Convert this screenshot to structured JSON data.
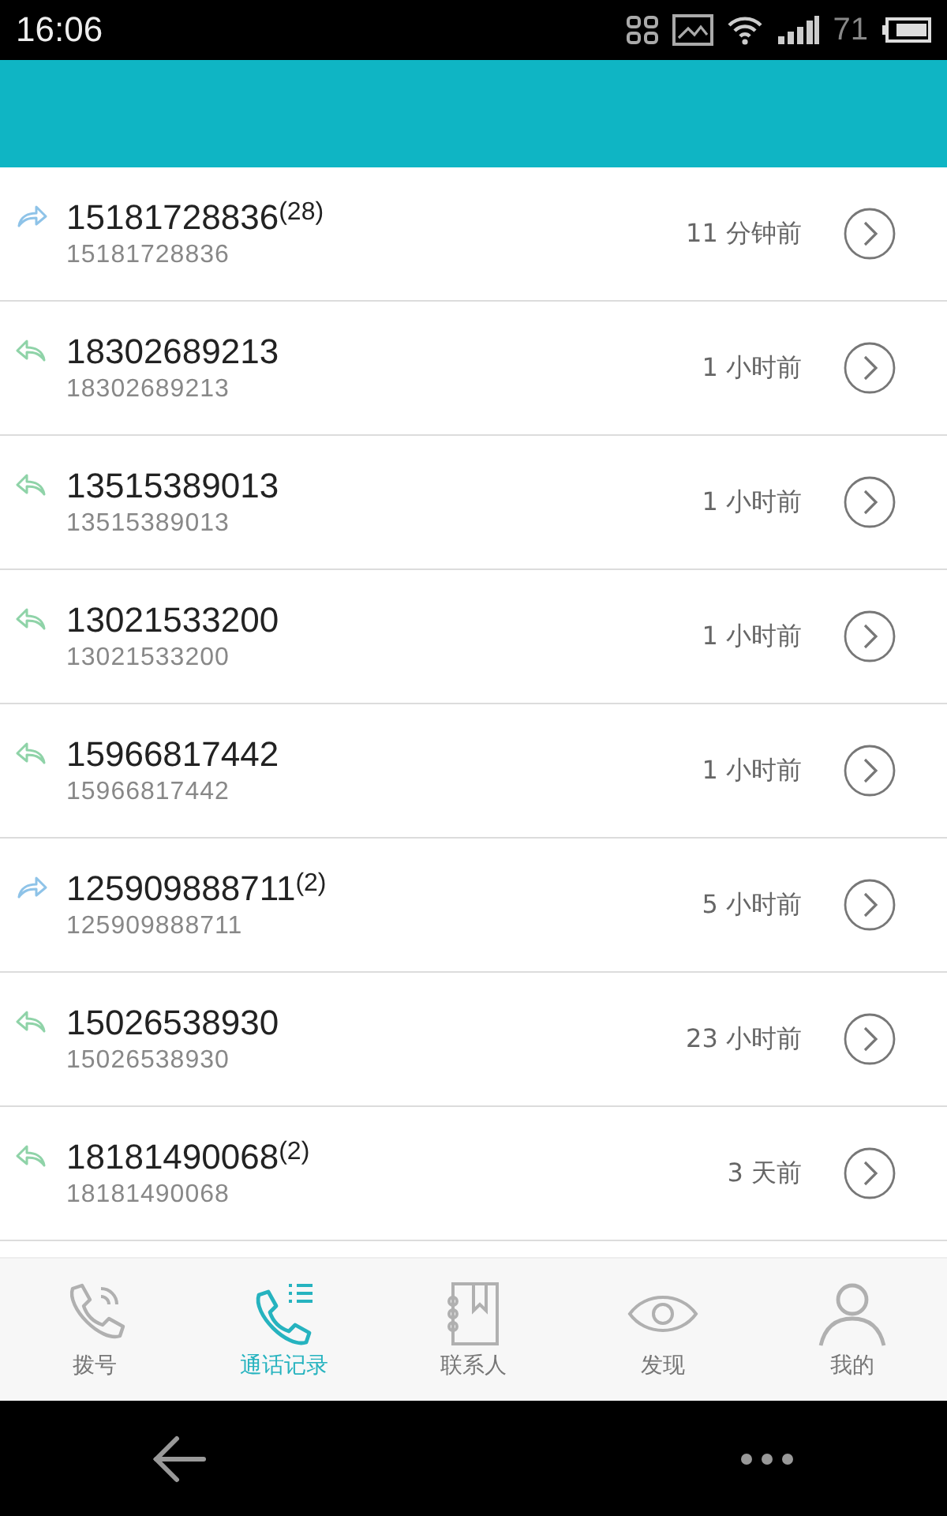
{
  "status_bar": {
    "time": "16:06",
    "battery_text": "71"
  },
  "calls": [
    {
      "kind": "outgoing",
      "number": "15181728836",
      "count": "(28)",
      "subtitle": "15181728836",
      "time": "11 分钟前"
    },
    {
      "kind": "incoming",
      "number": "18302689213",
      "subtitle": "18302689213",
      "time": "1 小时前"
    },
    {
      "kind": "incoming",
      "number": "13515389013",
      "subtitle": "13515389013",
      "time": "1 小时前"
    },
    {
      "kind": "incoming",
      "number": "13021533200",
      "subtitle": "13021533200",
      "time": "1 小时前"
    },
    {
      "kind": "incoming",
      "number": "15966817442",
      "subtitle": "15966817442",
      "time": "1 小时前"
    },
    {
      "kind": "outgoing",
      "number": "125909888711",
      "count": "(2)",
      "subtitle": "125909888711",
      "time": "5 小时前"
    },
    {
      "kind": "incoming",
      "number": "15026538930",
      "subtitle": "15026538930",
      "time": "23 小时前"
    },
    {
      "kind": "incoming",
      "number": "18181490068",
      "count": "(2)",
      "subtitle": "18181490068",
      "time": "3 天前"
    }
  ],
  "tabs": [
    {
      "kind": "dial",
      "label": "拨号",
      "selected": false
    },
    {
      "kind": "calllog",
      "label": "通话记录",
      "selected": true
    },
    {
      "kind": "contacts",
      "label": "联系人",
      "selected": false
    },
    {
      "kind": "discover",
      "label": "发现",
      "selected": false
    },
    {
      "kind": "me",
      "label": "我的",
      "selected": false
    }
  ]
}
